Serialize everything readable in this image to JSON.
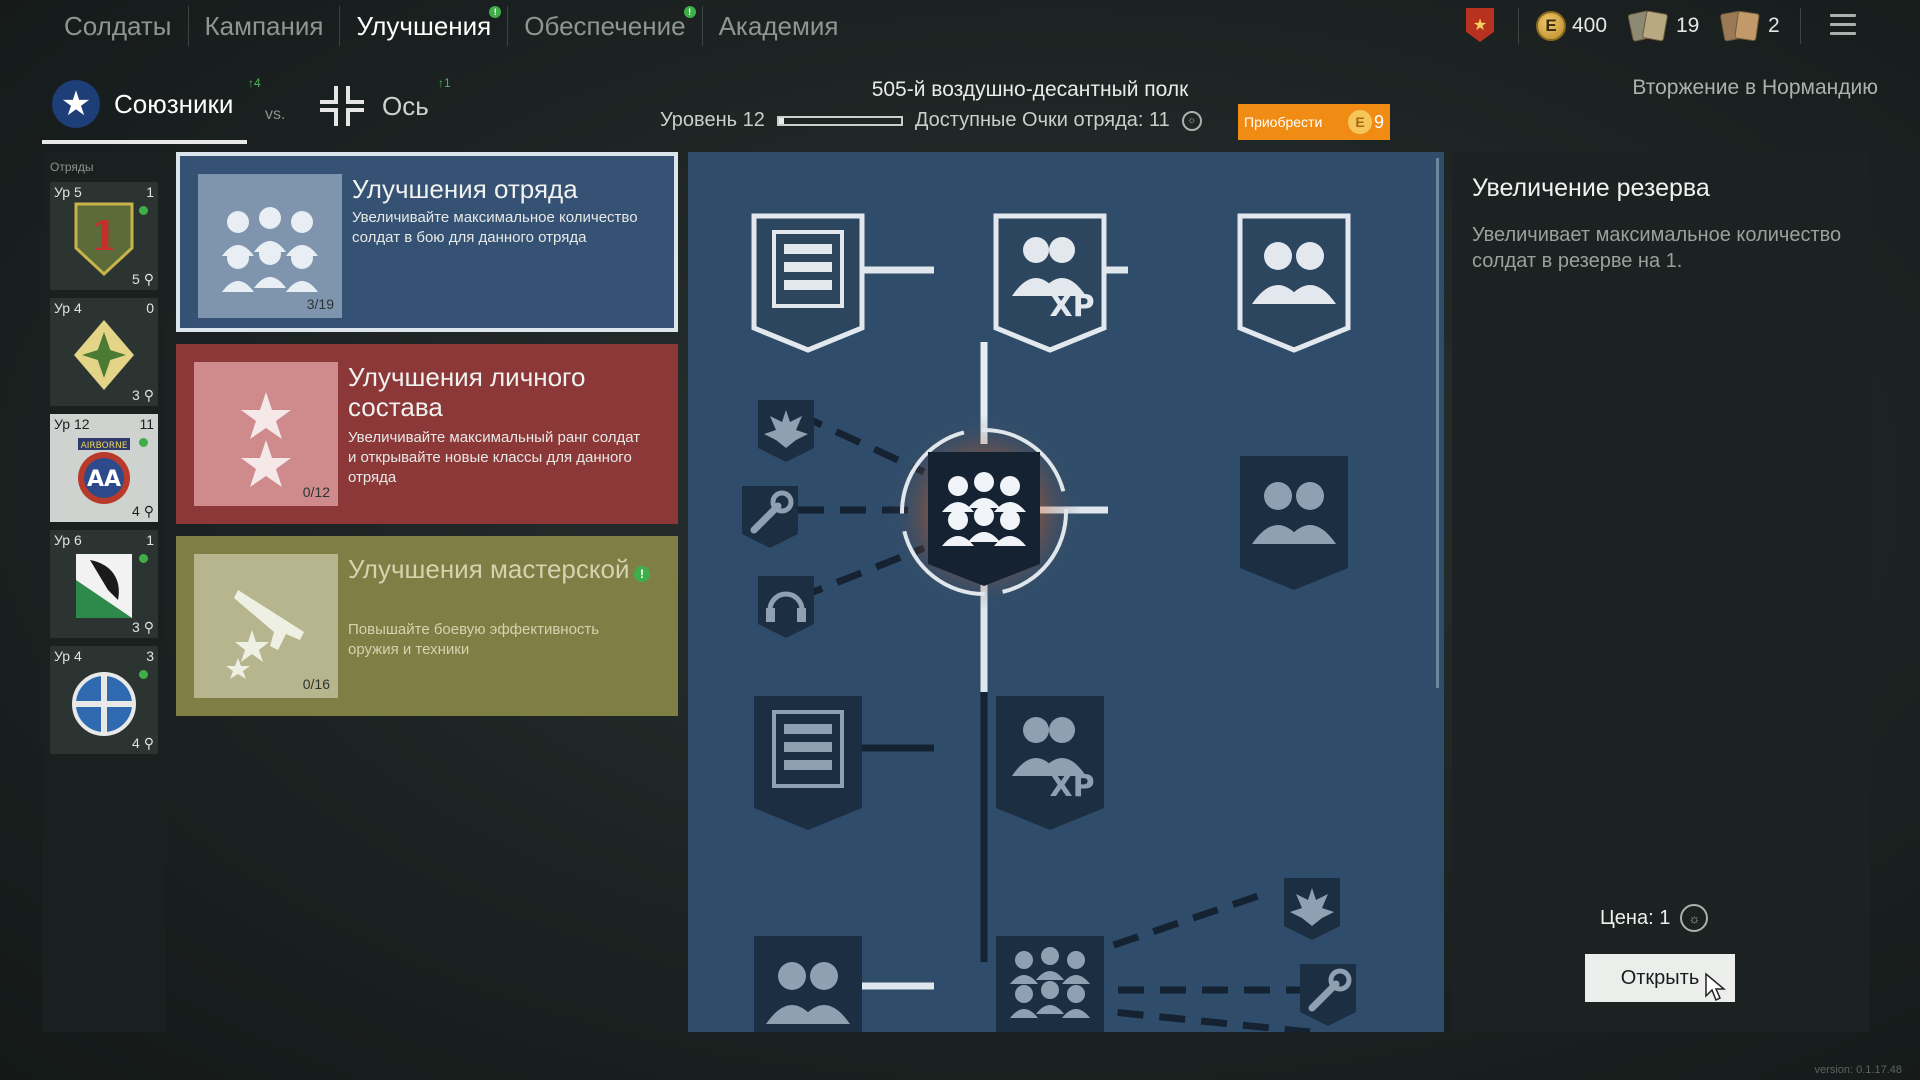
{
  "top_nav": {
    "tabs": [
      {
        "label": "Солдаты",
        "active": false,
        "notify": false
      },
      {
        "label": "Кампания",
        "active": false,
        "notify": false
      },
      {
        "label": "Улучшения",
        "active": true,
        "notify": true
      },
      {
        "label": "Обеспечение",
        "active": false,
        "notify": true
      },
      {
        "label": "Академия",
        "active": false,
        "notify": false
      }
    ],
    "silver": "400",
    "silver_icon": "E",
    "cards_a": "19",
    "cards_b": "2",
    "rank_icon": "★"
  },
  "factions": {
    "allies_label": "Союзники",
    "allies_notify": "↑4",
    "vs": "vs.",
    "axis_label": "Ось",
    "axis_notify": "↑1",
    "allies_icon": "★"
  },
  "header": {
    "regiment": "505-й воздушно-десантный полк",
    "level_label": "Уровень 12",
    "level_progress": 0.04,
    "points_label": "Доступные Очки отряда: 11",
    "buy_label": "Приобрести",
    "buy_price": "9",
    "gold_icon": "E",
    "campaign": "Вторжение в Нормандию"
  },
  "squads": {
    "title": "Отряды",
    "items": [
      {
        "level": "Ур 5",
        "points": "1",
        "count": "5",
        "emblem": "1"
      },
      {
        "level": "Ур 4",
        "points": "0",
        "count": "3",
        "emblem": ""
      },
      {
        "level": "Ур 12",
        "points": "11",
        "count": "4",
        "emblem": "AA",
        "tab": "AIRBORNE"
      },
      {
        "level": "Ур 6",
        "points": "1",
        "count": "3",
        "emblem": ""
      },
      {
        "level": "Ур 4",
        "points": "3",
        "count": "4",
        "emblem": ""
      }
    ]
  },
  "cards": [
    {
      "title": "Улучшения отряда",
      "desc": "Увеличивайте максимальное количество солдат в бою для данного отряда",
      "progress": "3/19"
    },
    {
      "title": "Улучшения личного состава",
      "desc": "Увеличивайте максимальный ранг солдат и открывайте новые классы для данного отряда",
      "progress": "0/12"
    },
    {
      "title": "Улучшения мастерской",
      "desc": "Повышайте боевую эффективность оружия и техники",
      "progress": "0/16",
      "notify": "!"
    }
  ],
  "tree": {
    "xp_label": "XP"
  },
  "detail": {
    "title": "Увеличение резерва",
    "desc": "Увеличивает максимальное количество солдат в резерве на 1.",
    "price_label": "Цена: 1",
    "open_button": "Открыть"
  },
  "version": "version: 0.1.17.48",
  "colors": {
    "squad_card": "#355173",
    "personnel_card": "#8c3838",
    "workshop_card": "#7f7e44",
    "tree_bg": "#2f4d6b",
    "buy_button": "#f08c13",
    "notify": "#3fae4a"
  }
}
